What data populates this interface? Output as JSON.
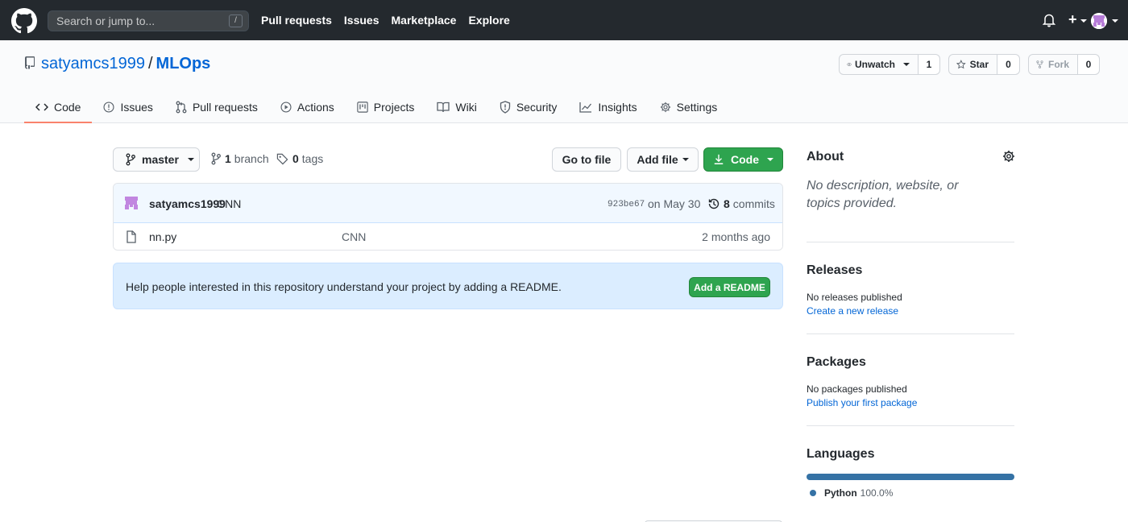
{
  "header": {
    "search_placeholder": "Search or jump to...",
    "search_shortcut": "/",
    "nav": [
      "Pull requests",
      "Issues",
      "Marketplace",
      "Explore"
    ],
    "plus_label": "+"
  },
  "repo": {
    "owner": "satyamcs1999",
    "separator": "/",
    "name": "MLOps",
    "unwatch_label": "Unwatch",
    "watch_count": "1",
    "star_label": "Star",
    "star_count": "0",
    "fork_label": "Fork",
    "fork_count": "0"
  },
  "tabs": [
    "Code",
    "Issues",
    "Pull requests",
    "Actions",
    "Projects",
    "Wiki",
    "Security",
    "Insights",
    "Settings"
  ],
  "toolbar": {
    "branch": "master",
    "branch_count": "1",
    "branch_word": "branch",
    "tag_count": "0",
    "tag_word": "tags",
    "goto_file": "Go to file",
    "add_file": "Add file",
    "code": "Code"
  },
  "latest_commit": {
    "author": "satyamcs1999",
    "message": "CNN",
    "sha": "923be67",
    "date": "on May 30",
    "count": "8",
    "count_word": "commits"
  },
  "files": [
    {
      "name": "nn.py",
      "message": "CNN",
      "age": "2 months ago"
    }
  ],
  "readme_prompt": {
    "text": "Help people interested in this repository understand your project by adding a README.",
    "button": "Add a README"
  },
  "sidebar": {
    "about": {
      "title": "About",
      "description": "No description, website, or topics provided."
    },
    "releases": {
      "title": "Releases",
      "status": "No releases published",
      "link": "Create a new release"
    },
    "packages": {
      "title": "Packages",
      "status": "No packages published",
      "link": "Publish your first package"
    },
    "languages": {
      "title": "Languages",
      "items": [
        {
          "name": "Python",
          "percent": "100.0%",
          "color": "#3572a5"
        }
      ]
    }
  },
  "colors": {
    "header_bg": "#24292e",
    "link": "#0366d6",
    "green": "#2ea44f",
    "tab_underline": "#f9826c",
    "readme_bg": "#dbedff"
  }
}
